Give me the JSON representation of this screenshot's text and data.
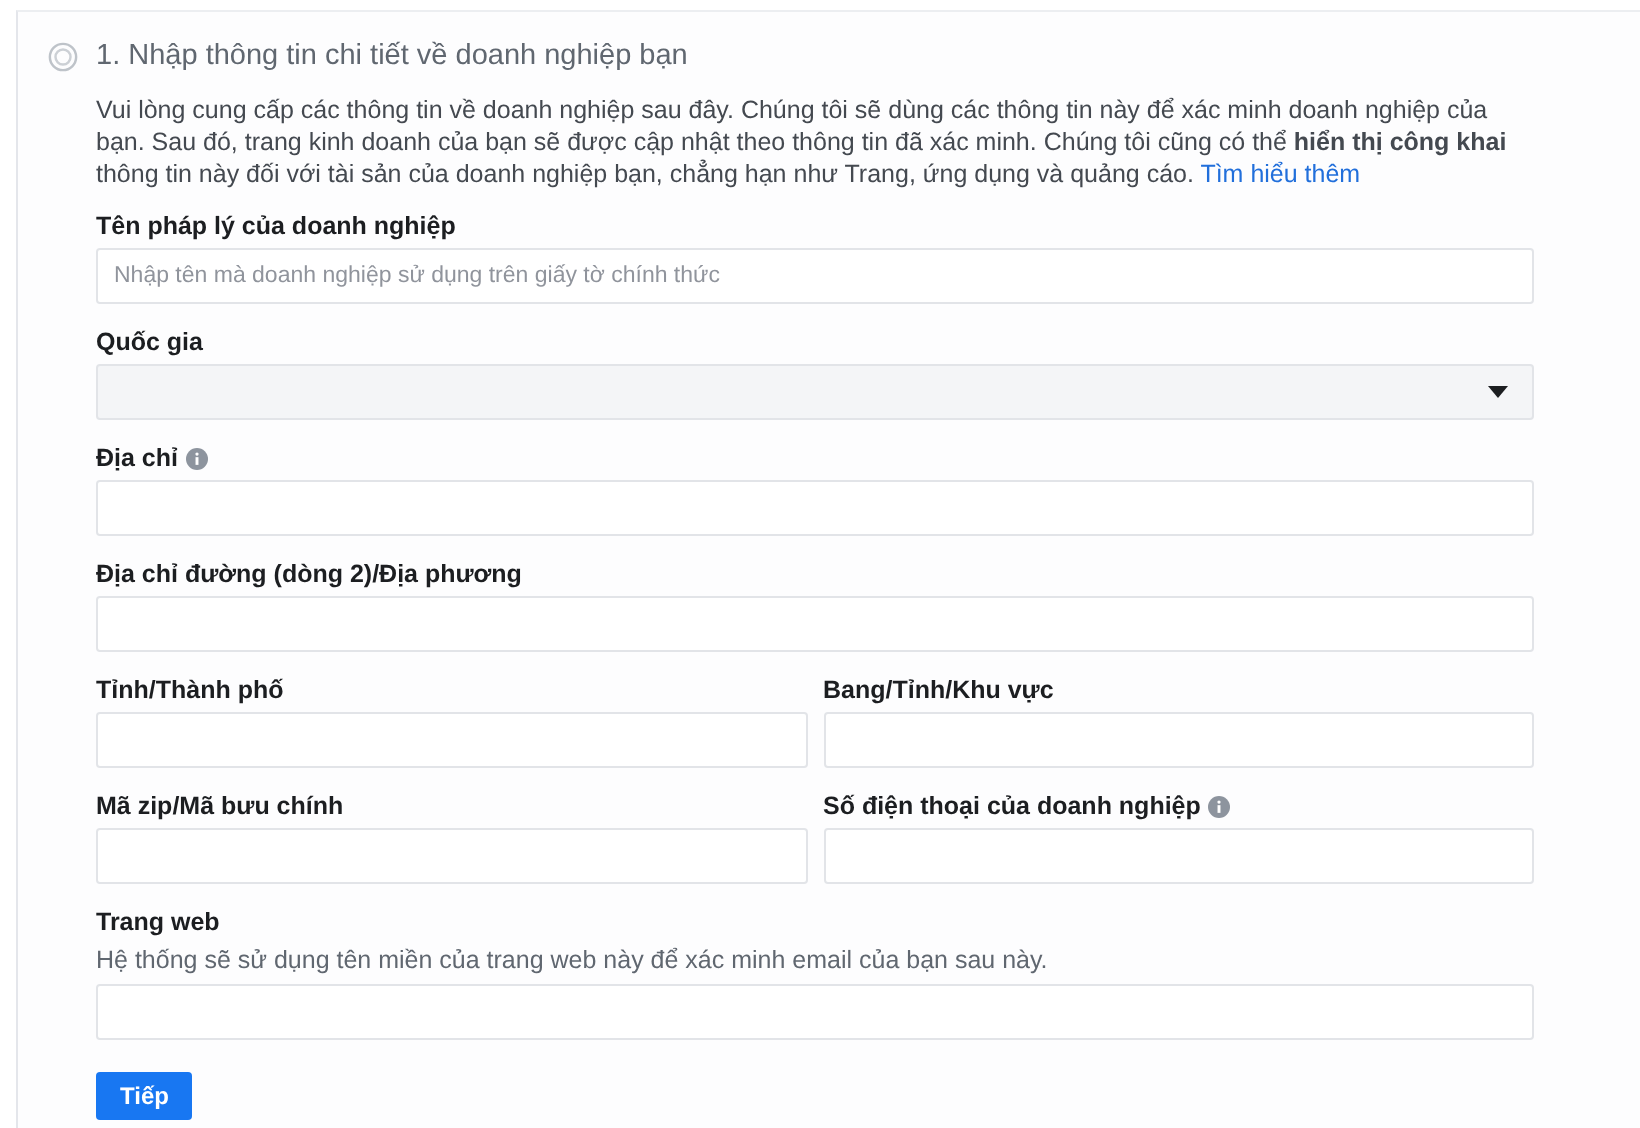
{
  "step": {
    "title": "1. Nhập thông tin chi tiết về doanh nghiệp bạn",
    "selected": false
  },
  "description": "Vui lòng cung cấp các thông tin về doanh nghiệp sau đây. Chúng tôi sẽ dùng các thông tin này để xác minh doanh nghiệp của bạn. Sau đó, trang kinh doanh của bạn sẽ được cập nhật theo thông tin đã xác minh. Chúng tôi cũng có thể **hiển thị công khai** thông tin này đối với tài sản của doanh nghiệp bạn, chẳng hạn như Trang, ứng dụng và quảng cáo.",
  "link": "Tìm hiểu thêm",
  "rows": [
    [
      {
        "kind": "text",
        "label": "Tên pháp lý của doanh nghiệp",
        "info": false,
        "placeholder": "Nhập tên mà doanh nghiệp sử dụng trên giấy tờ chính thức"
      }
    ],
    [
      {
        "kind": "select",
        "label": "Quốc gia",
        "info": false
      }
    ],
    [
      {
        "kind": "text",
        "label": "Địa chỉ",
        "info": true
      }
    ],
    [
      {
        "kind": "text",
        "label": "Địa chỉ đường (dòng 2)/Địa phương",
        "info": false
      }
    ],
    [
      {
        "kind": "text",
        "label": "Tỉnh/Thành phố",
        "info": false
      },
      {
        "kind": "text",
        "label": "Bang/Tỉnh/Khu vực",
        "info": false
      }
    ],
    [
      {
        "kind": "text",
        "label": "Mã zip/Mã bưu chính",
        "info": false
      },
      {
        "kind": "text",
        "label": "Số điện thoại của doanh nghiệp",
        "info": true
      }
    ],
    [
      {
        "kind": "text",
        "label": "Trang web",
        "info": false,
        "hint": "Hệ thống sẽ sử dụng tên miền của trang web này để xác minh email của bạn sau này."
      }
    ]
  ],
  "button": "Tiếp"
}
